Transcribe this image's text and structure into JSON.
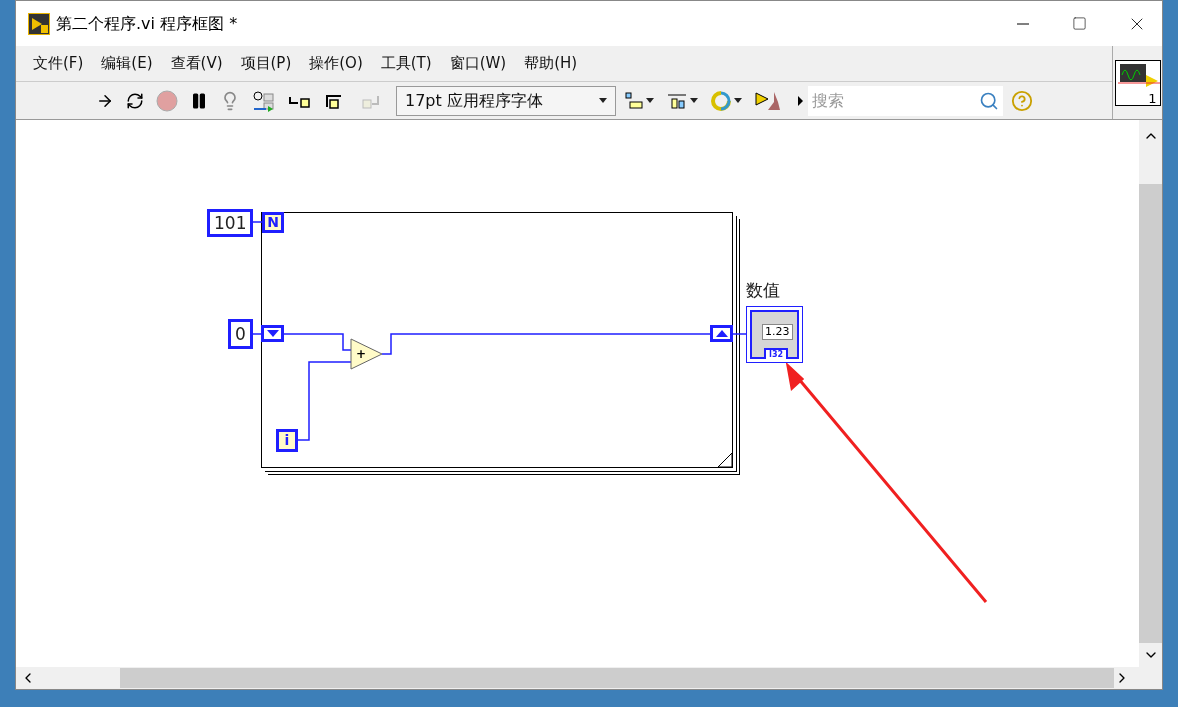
{
  "window": {
    "title": "第二个程序.vi 程序框图 *"
  },
  "menu": [
    "文件(F)",
    "编辑(E)",
    "查看(V)",
    "项目(P)",
    "操作(O)",
    "工具(T)",
    "窗口(W)",
    "帮助(H)"
  ],
  "toolbar": {
    "font_selector": "17pt 应用程序字体",
    "search": {
      "placeholder": "搜索"
    },
    "vi_icon_number": "1"
  },
  "diagram": {
    "for_loop": {
      "count_terminal": "N",
      "iteration_terminal": "i"
    },
    "constants": [
      {
        "value": "101"
      },
      {
        "value": "0"
      }
    ],
    "add_function": "+",
    "indicator": {
      "label": "数值",
      "value": "1.23",
      "type": "I32"
    }
  }
}
